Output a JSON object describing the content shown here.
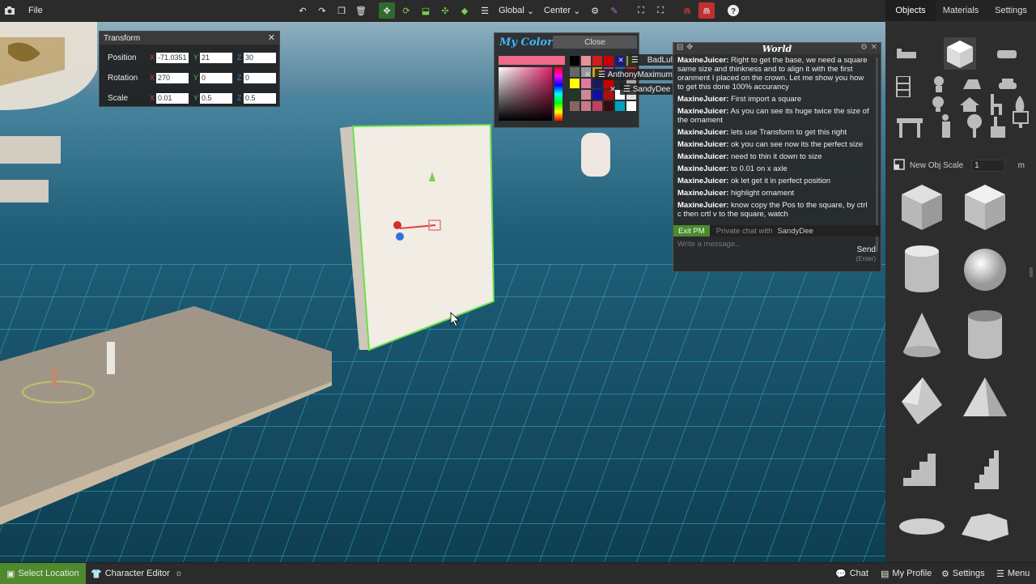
{
  "toolbar": {
    "file_label": "File",
    "space_mode": "Global",
    "pivot_mode": "Center",
    "icons": [
      "camera-icon",
      "undo-icon",
      "redo-icon",
      "duplicate-icon",
      "delete-icon",
      "move-icon",
      "rotate-icon",
      "scale-icon",
      "snap-icon",
      "bucket-icon",
      "list-icon",
      "physics-icon",
      "eyedropper-icon",
      "focus-icon",
      "frame-icon",
      "magnet-icon",
      "magnet-alt-icon",
      "help-icon"
    ]
  },
  "right_panel": {
    "tabs": [
      "Objects",
      "Materials",
      "Settings"
    ],
    "active_tab": "Objects",
    "new_obj_scale_label": "New Obj Scale",
    "new_obj_scale_value": "1",
    "new_obj_scale_unit": "m",
    "categories": [
      "bed-icon",
      "cube-icon",
      "sofa-icon",
      "shelf-icon",
      "plant-icon",
      "vehicle-icon",
      "lamp-icon",
      "roof-icon",
      "chair-icon",
      "car-icon",
      "table-icon",
      "figure-icon",
      "tree-icon",
      "sink-icon",
      "monitor-icon",
      "fire-icon"
    ],
    "primitives": [
      "cube",
      "rounded-cube",
      "cylinder",
      "sphere",
      "cone",
      "tube",
      "diamond",
      "pyramid",
      "stairs",
      "narrow-stairs",
      "pillow",
      "rock"
    ]
  },
  "transform": {
    "title": "Transform",
    "rows": [
      {
        "label": "Position",
        "x": "-71.0351",
        "y": "21",
        "z": "30"
      },
      {
        "label": "Rotation",
        "x": "270",
        "y": "0",
        "z": "0"
      },
      {
        "label": "Scale",
        "x": "0.01",
        "y": "0.5",
        "z": "0.5"
      }
    ]
  },
  "colors": {
    "title": "My Colors",
    "close_label": "Close",
    "current": "#f06a8a",
    "palette": [
      "#000000",
      "#e8909a",
      "#cc2020",
      "#cc0000",
      "#1a1a80",
      "#88aa30",
      "#666666",
      "#999999",
      "#c8a020",
      "#aa40aa",
      "#3060c0",
      "#cc2020",
      "#ffff00",
      "#e07aa0",
      "#1a1a60",
      "#cc0000",
      "#2a2a2a",
      "#aaaaaa",
      "#203a20",
      "#cc8899",
      "#1010a0",
      "#aa1010",
      "#ffffff",
      "#e0e0e0",
      "#886660",
      "#cc7788",
      "#c04060",
      "#3a0a0a",
      "#00a0c0",
      "#ffffff"
    ]
  },
  "users": [
    "BadLula",
    "AnthonyMaximum",
    "SandyDee"
  ],
  "world": {
    "title": "World",
    "messages": [
      {
        "name": "MaxineJuicer:",
        "text": " Right to get the base, we need a square same size and thinkness and to align it with the first oranment I placed on the crown. Let me show you how to get this done 100% accurancy"
      },
      {
        "name": "MaxineJuicer:",
        "text": " First import a square"
      },
      {
        "name": "MaxineJuicer:",
        "text": " As you can see its huge twice the size of the ornament"
      },
      {
        "name": "MaxineJuicer:",
        "text": " lets use Transform to get this right"
      },
      {
        "name": "MaxineJuicer:",
        "text": " ok you can see now its the perfect size"
      },
      {
        "name": "MaxineJuicer:",
        "text": " need to thin it down to size"
      },
      {
        "name": "MaxineJuicer:",
        "text": " to 0.01 on x axle"
      },
      {
        "name": "MaxineJuicer:",
        "text": " ok let get it in perfect position"
      },
      {
        "name": "MaxineJuicer:",
        "text": " highlight ornament"
      },
      {
        "name": "MaxineJuicer:",
        "text": " know copy the Pos to the square, by ctrl c then crtl v to the square, watch"
      }
    ],
    "exit_pm": "Exit PM",
    "private_label": "Private chat with",
    "private_name": "SandyDee",
    "input_placeholder": "Write a message...",
    "send_label": "Send",
    "send_hint": "(Enter)"
  },
  "bottom": {
    "select_location": "Select Location",
    "character_editor": "Character Editor",
    "chat": "Chat",
    "my_profile": "My Profile",
    "settings": "Settings",
    "menu": "Menu"
  }
}
